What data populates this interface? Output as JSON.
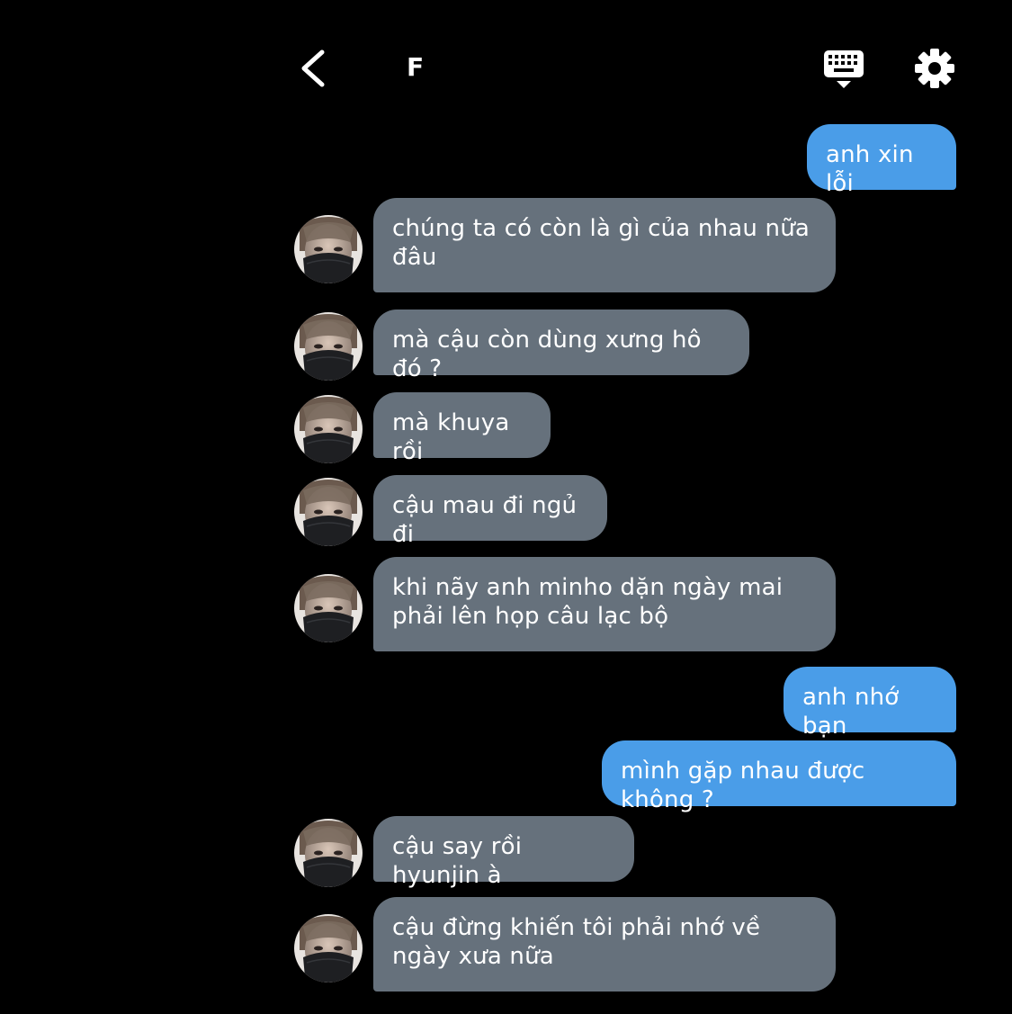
{
  "header": {
    "title": "F",
    "back_icon": "chevron-left-icon",
    "keyboard_icon": "keyboard-icon",
    "settings_icon": "gear-icon"
  },
  "colors": {
    "background": "#000000",
    "outgoing_bubble": "#4a9de8",
    "incoming_bubble": "#66717c",
    "text": "#ffffff"
  },
  "messages": [
    {
      "dir": "out",
      "text": "anh xin lỗi"
    },
    {
      "dir": "in",
      "text": "chúng ta có còn là gì của nhau nữa đâu"
    },
    {
      "dir": "in",
      "text": "mà cậu còn dùng xưng hô đó ?"
    },
    {
      "dir": "in",
      "text": "mà khuya rồi"
    },
    {
      "dir": "in",
      "text": "cậu mau đi ngủ đi"
    },
    {
      "dir": "in",
      "text": "khi nãy anh minho dặn ngày mai phải lên họp câu lạc bộ"
    },
    {
      "dir": "out",
      "text": "anh nhớ bạn"
    },
    {
      "dir": "out",
      "text": "mình gặp nhau được không ?"
    },
    {
      "dir": "in",
      "text": "cậu say rồi hyunjin à"
    },
    {
      "dir": "in",
      "text": "cậu đừng khiến tôi phải nhớ về ngày xưa nữa"
    }
  ]
}
